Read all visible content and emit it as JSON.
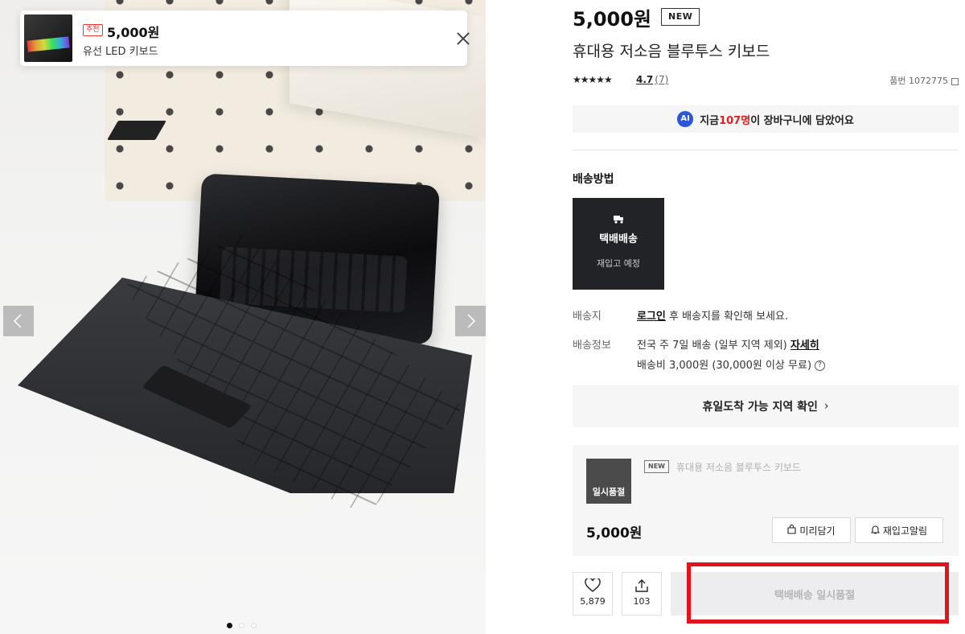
{
  "toast": {
    "badge": "추천",
    "price": "5,000원",
    "name": "유선 LED 키보드"
  },
  "gallery": {
    "slide_count": 3,
    "active_slide": 1
  },
  "product": {
    "price": "5,000원",
    "new_badge": "NEW",
    "title": "휴대용 저소음 블루투스 키보드",
    "stars": "★★★★★",
    "rating": "4.7",
    "review_count": "(7)",
    "sku": "품번 1072775"
  },
  "ai_banner": {
    "icon": "AI",
    "prefix": "지금 ",
    "count": "107명",
    "suffix": "이 장바구니에 담았어요"
  },
  "shipping": {
    "heading": "배송방법",
    "method_label": "택배배송",
    "method_status": "재입고 예정",
    "dest_label": "배송지",
    "dest_login": "로그인",
    "dest_text": " 후 배송지를 확인해 보세요.",
    "info_label": "배송정보",
    "info_text": "전국 주 7일 배송 (일부 지역 제외) ",
    "info_link": "자세히",
    "fee_text": "배송비 3,000원 (30,000원 이상 무료)",
    "region_check": "휴일도착 가능 지역 확인"
  },
  "option": {
    "sold_label": "일시품절",
    "new_badge": "NEW",
    "name": "휴대용 저소음 블루투스 키보드",
    "price": "5,000원",
    "wish_label": "미리담기",
    "notify_label": "재입고알림"
  },
  "actions": {
    "like_count": "5,879",
    "share_count": "103",
    "soldout_label": "택배배송 일시품절"
  },
  "colors": {
    "accent_red": "#e21f1f",
    "highlight_box": "#e0141c",
    "ai_blue": "#2a55d6",
    "dark_card": "#212327"
  }
}
